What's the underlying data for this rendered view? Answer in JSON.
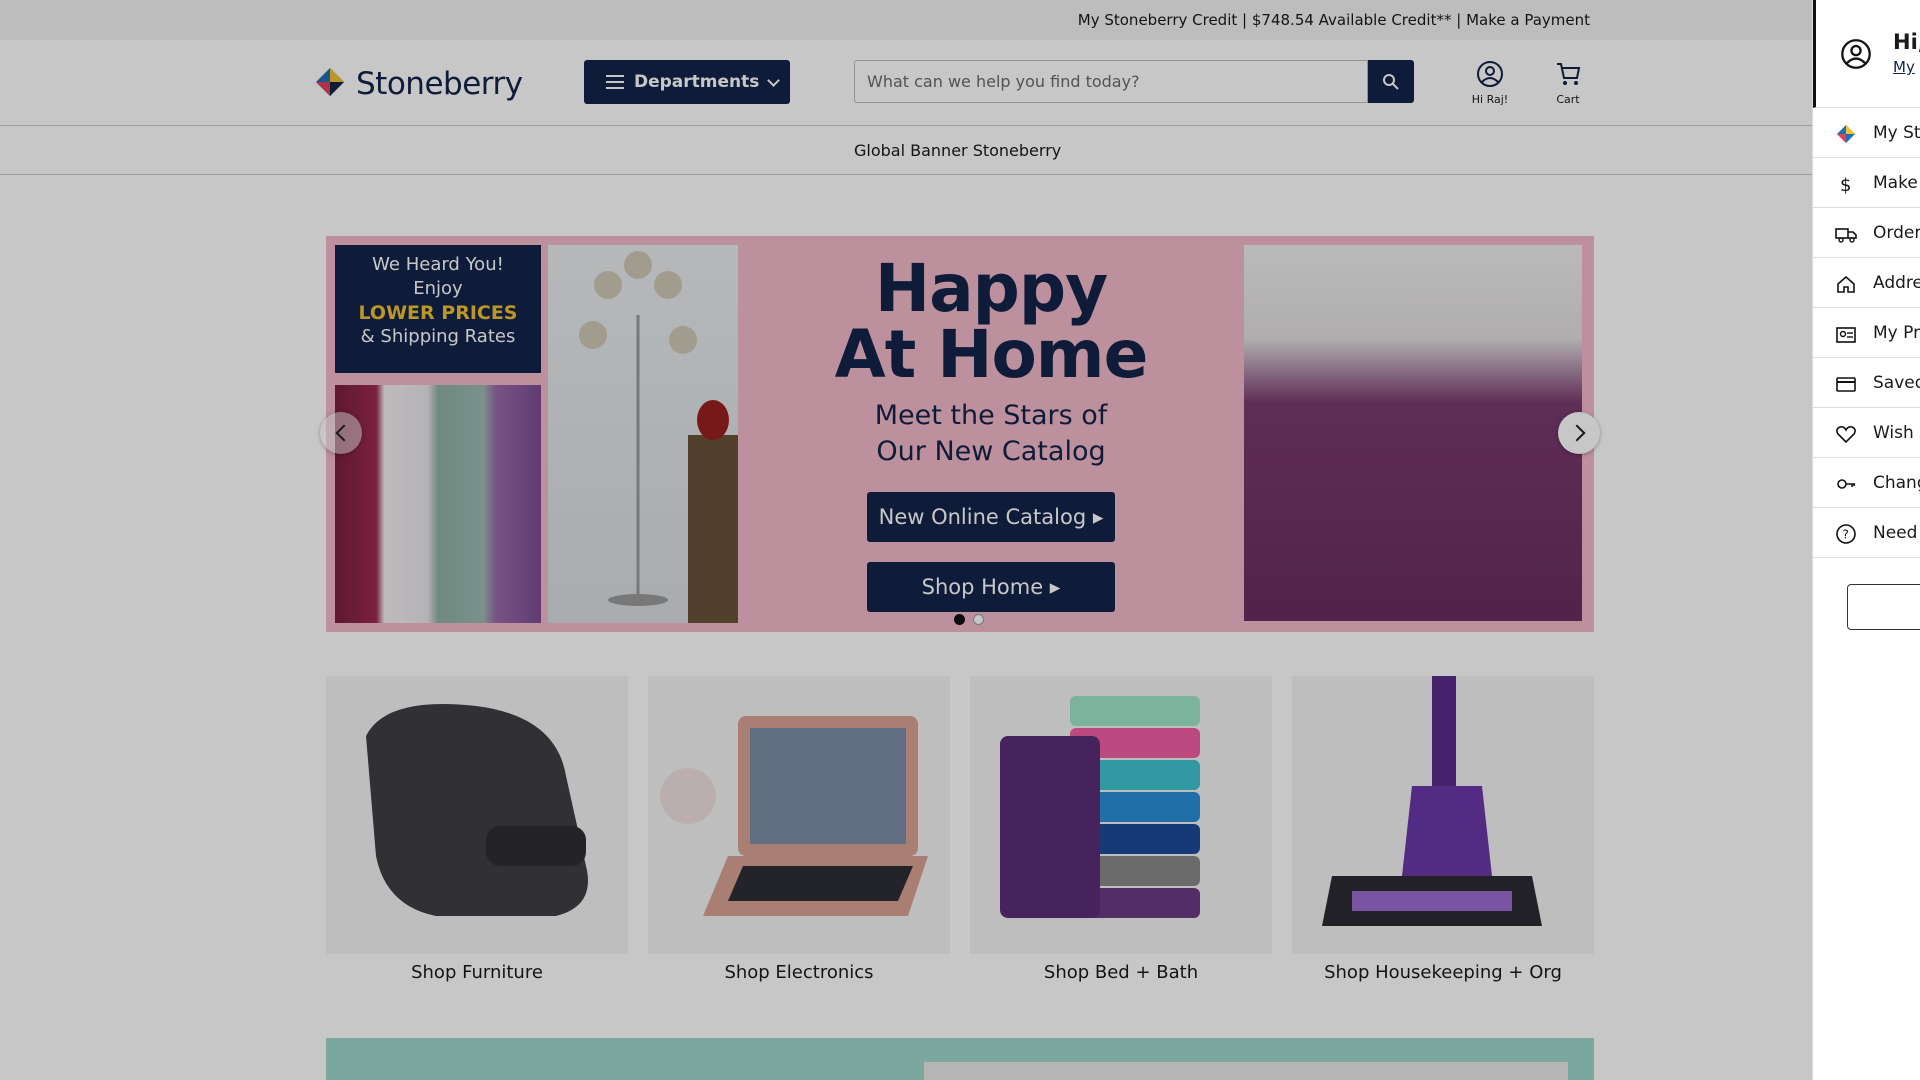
{
  "topbar": {
    "credit_label": "My Stoneberry Credit",
    "available_credit": "$748.54 Available Credit**",
    "make_payment": "Make a Payment",
    "separator": "|"
  },
  "header": {
    "logo_text": "Stoneberry",
    "departments_label": "Departments",
    "search_placeholder": "What can we help you find today?",
    "account_label": "Hi Raj!",
    "cart_label": "Cart"
  },
  "subnav": {
    "text": "Global Banner Stoneberry"
  },
  "hero": {
    "badge_line1": "We Heard You!",
    "badge_line2": "Enjoy",
    "badge_line3": "LOWER PRICES",
    "badge_line4": "& Shipping Rates",
    "title_line1": "Happy",
    "title_line2": "At Home",
    "subtitle_line1": "Meet the Stars of",
    "subtitle_line2": "Our New Catalog",
    "button1": "New Online Catalog ▸",
    "button2": "Shop Home ▸",
    "active_slide": 1,
    "slide_count": 2
  },
  "categories": [
    {
      "label": "Shop Furniture"
    },
    {
      "label": "Shop Electronics"
    },
    {
      "label": "Shop Bed + Bath"
    },
    {
      "label": "Shop Housekeeping + Org"
    }
  ],
  "drawer": {
    "greeting": "Hi,",
    "account_link": "My ",
    "items": [
      {
        "label": "My Sto",
        "icon": "stoneberry-logo-icon"
      },
      {
        "label": "Make",
        "icon": "dollar-icon"
      },
      {
        "label": "Order",
        "icon": "truck-icon"
      },
      {
        "label": "Addre",
        "icon": "home-icon"
      },
      {
        "label": "My Pr",
        "icon": "profile-card-icon"
      },
      {
        "label": "Saved",
        "icon": "credit-card-icon"
      },
      {
        "label": "Wish L",
        "icon": "heart-icon"
      },
      {
        "label": "Chang",
        "icon": "key-icon"
      },
      {
        "label": "Need ",
        "icon": "help-circle-icon"
      }
    ]
  },
  "colors": {
    "navy": "#14244a",
    "hero_pink": "#f1b9c8",
    "gold": "#f2c230"
  }
}
